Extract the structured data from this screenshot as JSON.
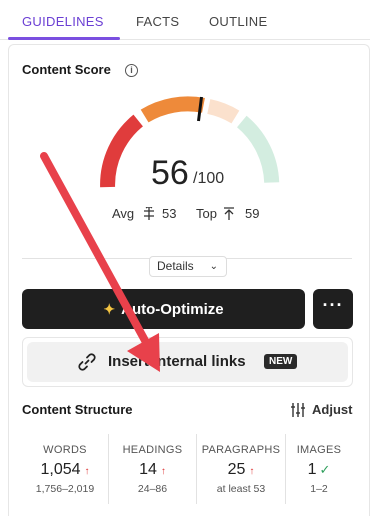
{
  "tabs": [
    {
      "label": "GUIDELINES",
      "active": true
    },
    {
      "label": "FACTS",
      "active": false
    },
    {
      "label": "OUTLINE",
      "active": false
    }
  ],
  "content_score": {
    "title": "Content Score",
    "info_icon": "i",
    "score": "56",
    "max": "/100",
    "avg_label": "Avg",
    "avg_value": "53",
    "top_label": "Top",
    "top_value": "59"
  },
  "gauge": {
    "colors": {
      "low": "#e03c3c",
      "mid": "#ee8a3a",
      "mid_light": "#fbe1cd",
      "high": "#d3ede0"
    }
  },
  "details_button": {
    "label": "Details",
    "icon": "chevron-down-icon"
  },
  "auto_optimize": {
    "label": "Auto-Optimize",
    "icon": "sparkle-icon"
  },
  "more_button": {
    "label": "···"
  },
  "internal_links": {
    "label": "Insert internal links",
    "badge": "NEW",
    "icon": "link-icon"
  },
  "content_structure": {
    "title": "Content Structure",
    "adjust_label": "Adjust",
    "stats": [
      {
        "label": "WORDS",
        "value": "1,054",
        "indicator": "↑",
        "range": "1,756–2,019"
      },
      {
        "label": "HEADINGS",
        "value": "14",
        "indicator": "↑",
        "range": "24–86"
      },
      {
        "label": "PARAGRAPHS",
        "value": "25",
        "indicator": "↑",
        "range": "at least 53"
      },
      {
        "label": "IMAGES",
        "value": "1",
        "indicator": "✓",
        "range": "1–2"
      }
    ]
  },
  "annotation": {
    "arrow_color": "#e8414b"
  }
}
